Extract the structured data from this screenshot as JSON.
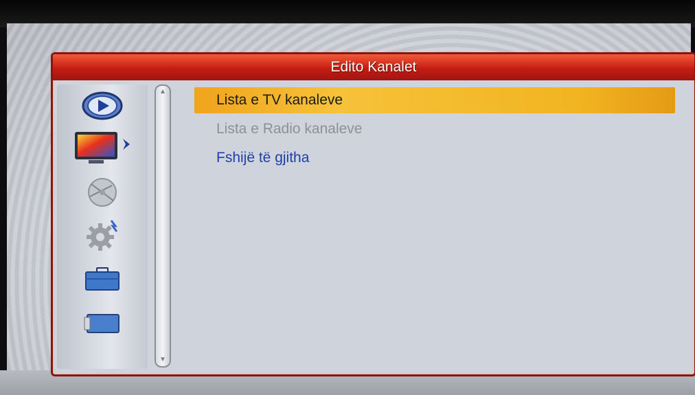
{
  "window": {
    "title": "Edito Kanalet"
  },
  "sidebar": {
    "icons": [
      {
        "name": "play-icon",
        "active": false
      },
      {
        "name": "tv-icon",
        "active": true
      },
      {
        "name": "satellite-dish-icon",
        "active": false
      },
      {
        "name": "settings-gear-icon",
        "active": false
      },
      {
        "name": "toolbox-icon",
        "active": false
      },
      {
        "name": "media-icon",
        "active": false
      }
    ]
  },
  "menu": {
    "items": [
      {
        "label": "Lista e TV kanaleve",
        "state": "selected"
      },
      {
        "label": "Lista e Radio kanaleve",
        "state": "disabled"
      },
      {
        "label": "Fshijë të gjitha",
        "state": "normal"
      }
    ]
  },
  "colors": {
    "title_bar": "#c51d12",
    "highlight": "#f2b421",
    "item_text": "#1f3fa8",
    "disabled_text": "#8e9096"
  }
}
